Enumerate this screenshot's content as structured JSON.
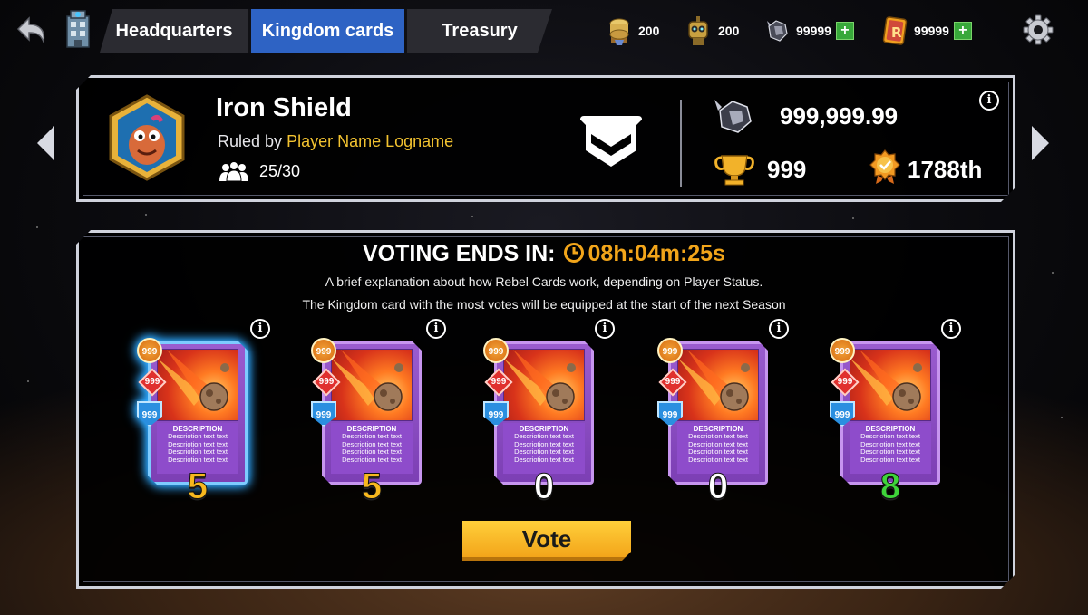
{
  "tabs": [
    {
      "label": "Headquarters"
    },
    {
      "label": "Kingdom cards"
    },
    {
      "label": "Treasury"
    }
  ],
  "resources": [
    {
      "icon": "coin-stack-icon",
      "value": "200"
    },
    {
      "icon": "robot-icon",
      "value": "200"
    },
    {
      "icon": "gem-icon",
      "value": "99999"
    },
    {
      "icon": "rebel-card-icon",
      "value": "99999"
    }
  ],
  "kingdom": {
    "name": "Iron Shield",
    "ruled_prefix": "Ruled by",
    "ruler": "Player Name Logname",
    "members": "25/30",
    "gems": "999,999.99",
    "trophies": "999",
    "rank": "1788th"
  },
  "voting": {
    "title": "VOTING ENDS IN:",
    "timer": "08h:04m:25s",
    "line1": "A brief explanation about how Rebel Cards work, depending on Player Status.",
    "line2": "The Kingdom card with the most votes will be equipped at the start of the next Season",
    "vote_label": "Vote"
  },
  "cards": [
    {
      "stat_orange": "999",
      "stat_red": "999",
      "stat_blue": "999",
      "desc_title": "DESCRIPTION",
      "desc_lines": [
        "Descriotion text text",
        "Descriotion text text",
        "Descriotion text text",
        "Descriotion text text"
      ],
      "votes": "5",
      "votes_color": "#f7b81e",
      "selected": true
    },
    {
      "stat_orange": "999",
      "stat_red": "999",
      "stat_blue": "999",
      "desc_title": "DESCRIPTION",
      "desc_lines": [
        "Descriotion text text",
        "Descriotion text text",
        "Descriotion text text",
        "Descriotion text text"
      ],
      "votes": "5",
      "votes_color": "#f7b81e",
      "selected": false
    },
    {
      "stat_orange": "999",
      "stat_red": "999",
      "stat_blue": "999",
      "desc_title": "DESCRIPTION",
      "desc_lines": [
        "Descriotion text text",
        "Descriotion text text",
        "Descriotion text text",
        "Descriotion text text"
      ],
      "votes": "0",
      "votes_color": "#ffffff",
      "selected": false
    },
    {
      "stat_orange": "999",
      "stat_red": "999",
      "stat_blue": "999",
      "desc_title": "DESCRIPTION",
      "desc_lines": [
        "Descriotion text text",
        "Descriotion text text",
        "Descriotion text text",
        "Descriotion text text"
      ],
      "votes": "0",
      "votes_color": "#ffffff",
      "selected": false
    },
    {
      "stat_orange": "999",
      "stat_red": "999",
      "stat_blue": "999",
      "desc_title": "DESCRIPTION",
      "desc_lines": [
        "Descriotion text text",
        "Descriotion text text",
        "Descriotion text text",
        "Descriotion text text"
      ],
      "votes": "8",
      "votes_color": "#3fd43a",
      "selected": false
    }
  ],
  "colors": {
    "active_tab": "#2e63c4",
    "accent_gold": "#f2a51a",
    "ruler_name": "#f2c230"
  }
}
